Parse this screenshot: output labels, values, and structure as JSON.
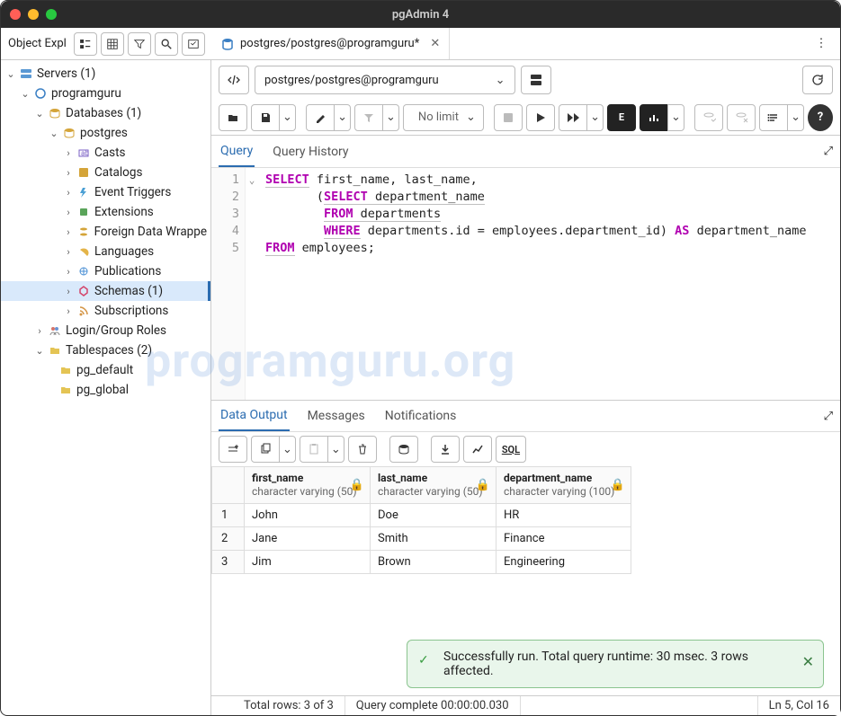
{
  "window_title": "pgAdmin 4",
  "object_explorer_label": "Object Expl",
  "tab": {
    "label": "postgres/postgres@programguru*"
  },
  "connection": {
    "value": "postgres/postgres@programguru"
  },
  "toolbar": {
    "limit": "No limit"
  },
  "query_tabs": {
    "query": "Query",
    "history": "Query History"
  },
  "sql": {
    "lines": [
      "1",
      "2",
      "3",
      "4",
      "5"
    ],
    "line1_select": "SELECT",
    "line1_rest": " first_name, last_name,",
    "line2_open": "       (",
    "line2_select": "SELECT",
    "line2_rest": " department_name",
    "line3_pad": "        ",
    "line3_from": "FROM",
    "line3_rest": " departments",
    "line4_pad": "        ",
    "line4_where": "WHERE",
    "line4_mid": " departments.id = employees.department_id) ",
    "line4_as": "AS",
    "line4_rest": " department_name",
    "line5_from": "FROM",
    "line5_rest": " employees;"
  },
  "output_tabs": {
    "data": "Data Output",
    "messages": "Messages",
    "notifications": "Notifications"
  },
  "columns": [
    {
      "name": "first_name",
      "type": "character varying (50)"
    },
    {
      "name": "last_name",
      "type": "character varying (50)"
    },
    {
      "name": "department_name",
      "type": "character varying (100)"
    }
  ],
  "rows": [
    {
      "n": "1",
      "c0": "John",
      "c1": "Doe",
      "c2": "HR"
    },
    {
      "n": "2",
      "c0": "Jane",
      "c1": "Smith",
      "c2": "Finance"
    },
    {
      "n": "3",
      "c0": "Jim",
      "c1": "Brown",
      "c2": "Engineering"
    }
  ],
  "tree": {
    "servers": "Servers (1)",
    "programguru": "programguru",
    "databases": "Databases (1)",
    "postgres": "postgres",
    "casts": "Casts",
    "catalogs": "Catalogs",
    "event_triggers": "Event Triggers",
    "extensions": "Extensions",
    "fdw": "Foreign Data Wrappe",
    "languages": "Languages",
    "publications": "Publications",
    "schemas": "Schemas (1)",
    "subscriptions": "Subscriptions",
    "login_roles": "Login/Group Roles",
    "tablespaces": "Tablespaces (2)",
    "pg_default": "pg_default",
    "pg_global": "pg_global"
  },
  "toast": {
    "text": "Successfully run. Total query runtime: 30 msec. 3 rows affected."
  },
  "status": {
    "rows": "Total rows: 3 of 3",
    "complete": "Query complete 00:00:00.030",
    "cursor": "Ln 5, Col 16"
  },
  "watermark": "programguru.org"
}
